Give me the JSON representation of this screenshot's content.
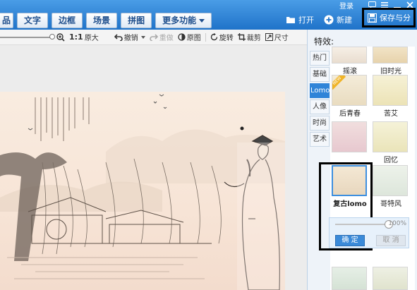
{
  "toolbar": {
    "tabs": [
      {
        "label": "品"
      },
      {
        "label": "文字"
      },
      {
        "label": "边框"
      },
      {
        "label": "场景"
      },
      {
        "label": "拼图"
      },
      {
        "label": "更多功能"
      }
    ],
    "login_label": "登录",
    "window_controls": [
      "chat-icon",
      "menu-icon",
      "minimize-icon",
      "close-icon"
    ],
    "open_label": "打开",
    "new_label": "新建",
    "save_label": "保存与分"
  },
  "subbar": {
    "ratio_label": "1:1",
    "original_size_label": "原大",
    "undo_label": "撤销",
    "redo_label": "重做",
    "original_label": "原图",
    "rotate_label": "旋转",
    "crop_label": "裁剪",
    "size_label": "尺寸"
  },
  "effects_panel": {
    "title": "特效:",
    "categories": [
      "热门",
      "基础",
      "Lomo",
      "人像",
      "时尚",
      "艺术"
    ],
    "active_category": "Lomo",
    "effects": [
      {
        "label": "摇滚"
      },
      {
        "label": "旧时光"
      },
      {
        "label": "后青春"
      },
      {
        "label": "苦艾"
      },
      {
        "label": "回忆"
      },
      {
        "label": "复古lomo"
      },
      {
        "label": "哥特风"
      }
    ],
    "new_badge": "NEW",
    "selected_effect": "复古lomo",
    "strength_percent": "100%",
    "confirm_label": "确 定",
    "cancel_label": "取 消"
  },
  "colors": {
    "toolbar_blue": "#2b7fd5",
    "accent_blue": "#2f84d8",
    "photo_tint": "#f7e4d6"
  }
}
